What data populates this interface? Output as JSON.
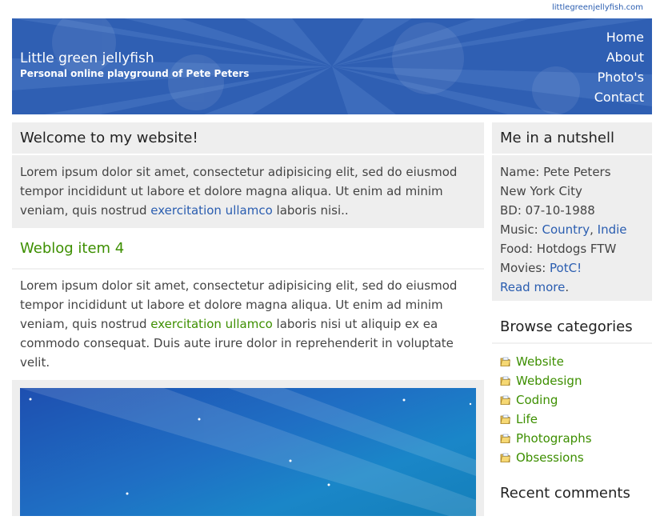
{
  "top_link": "littlegreenjellyfish.com",
  "header": {
    "title": "Little green jellyfish",
    "subtitle": "Personal online playground of Pete Peters"
  },
  "nav": [
    {
      "label": "Home"
    },
    {
      "label": "About"
    },
    {
      "label": "Photo's"
    },
    {
      "label": "Contact"
    }
  ],
  "welcome": {
    "title": "Welcome to my website!",
    "text_before": "Lorem ipsum dolor sit amet, consectetur adipisicing elit, sed do eiusmod tempor incididunt ut labore et dolore magna aliqua. Ut enim ad minim veniam, quis nostrud ",
    "link": "exercitation ullamco",
    "text_after": " laboris nisi.."
  },
  "post": {
    "title": "Weblog item 4",
    "text_before": "Lorem ipsum dolor sit amet, consectetur adipisicing elit, sed do eiusmod tempor incididunt ut labore et dolore magna aliqua. Ut enim ad minim veniam, quis nostrud ",
    "link": "exercitation ullamco",
    "text_after": " laboris nisi ut aliquip ex ea commodo consequat. Duis aute irure dolor in reprehenderit in voluptate velit."
  },
  "nutshell": {
    "title": "Me in a nutshell",
    "name": "Name: Pete Peters",
    "city": "New York City",
    "birthday": "BD: 07-10-1988",
    "music_label": "Music: ",
    "music_1": "Country",
    "music_sep": ", ",
    "music_2": "Indie",
    "food": "Food: Hotdogs FTW",
    "movies_label": "Movies: ",
    "movies_link": "PotC!",
    "read_more": "Read more",
    "read_more_suffix": "."
  },
  "categories": {
    "title": "Browse categories",
    "items": [
      {
        "label": "Website"
      },
      {
        "label": "Webdesign"
      },
      {
        "label": "Coding"
      },
      {
        "label": "Life"
      },
      {
        "label": "Photographs"
      },
      {
        "label": "Obsessions"
      }
    ]
  },
  "recent_comments": {
    "title": "Recent comments"
  },
  "colors": {
    "header_blue": "#2f5fb3",
    "link_blue": "#2a5db0",
    "link_green": "#3d8f00",
    "box_grey": "#eeeeee"
  },
  "icons": {
    "category": "folder-icon"
  }
}
